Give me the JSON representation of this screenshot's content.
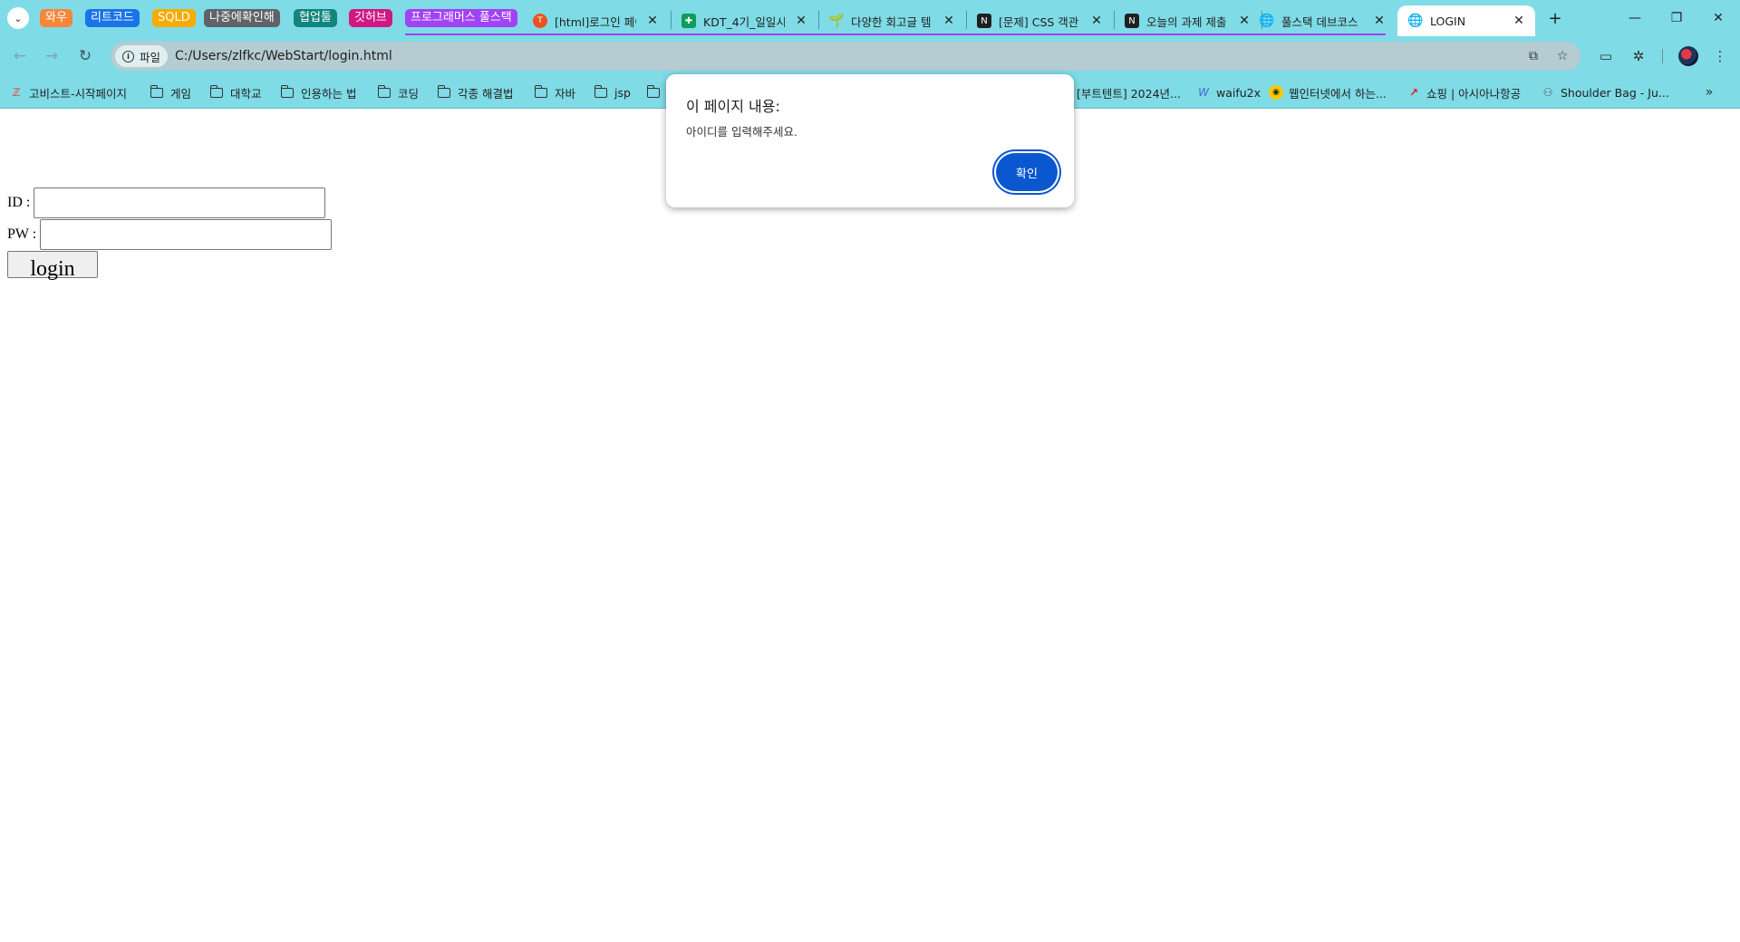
{
  "tab_groups": [
    {
      "label": "와우",
      "color": "#f6863a"
    },
    {
      "label": "리트코드",
      "color": "#1a73e8"
    },
    {
      "label": "SQLD",
      "color": "#f9ab00"
    },
    {
      "label": "나중에확인해",
      "color": "#5f6368"
    },
    {
      "label": "협업툴",
      "color": "#12857c"
    },
    {
      "label": "깃허브",
      "color": "#d01884"
    },
    {
      "label": "프로그래머스 풀스택",
      "color": "#a142f4"
    }
  ],
  "tabs": [
    {
      "title": "[html]로그인 페이",
      "icon": "tistory-icon",
      "color": "#eb531f"
    },
    {
      "title": "KDT_4기_일일시",
      "icon": "sheets-icon",
      "color": "#0f9d58"
    },
    {
      "title": "다양한 회고글 템",
      "icon": "sprout-icon",
      "color": "#2e7d32"
    },
    {
      "title": "[문제] CSS 객관",
      "icon": "notion-icon",
      "color": "#1f1f1f"
    },
    {
      "title": "오늘의 과제 제출",
      "icon": "notion-icon",
      "color": "#1f1f1f"
    },
    {
      "title": "풀스택 데브코스",
      "icon": "globe-icon",
      "color": "#5f6368"
    },
    {
      "title": "LOGIN",
      "icon": "globe-icon",
      "color": "#5f6368"
    }
  ],
  "omnibox": {
    "chip_label": "파일",
    "url": "C:/Users/zlfkc/WebStart/login.html"
  },
  "bookmarks": [
    {
      "label": "고비스트-시작페이지",
      "icon": "zum-icon"
    },
    {
      "label": "게임",
      "icon": "folder-icon"
    },
    {
      "label": "대학교",
      "icon": "folder-icon"
    },
    {
      "label": "인용하는 법",
      "icon": "folder-icon"
    },
    {
      "label": "코딩",
      "icon": "folder-icon"
    },
    {
      "label": "각종 해결법",
      "icon": "folder-icon"
    },
    {
      "label": "자바",
      "icon": "folder-icon"
    },
    {
      "label": "jsp",
      "icon": "folder-icon"
    },
    {
      "label": "",
      "icon": "folder-icon"
    },
    {
      "label": "[부트텐트] 2024년...",
      "icon": "folder-icon"
    },
    {
      "label": "waifu2x",
      "icon": "waifu-icon"
    },
    {
      "label": "웹인터넷에서 하는...",
      "icon": "webtoon-icon"
    },
    {
      "label": "쇼핑 | 아시아나항공",
      "icon": "asiana-icon"
    },
    {
      "label": "Shoulder Bag - Ju...",
      "icon": "bag-icon"
    }
  ],
  "form": {
    "id_label": "ID : ",
    "pw_label": "PW : ",
    "id_value": "",
    "pw_value": "",
    "login_label": "login"
  },
  "dialog": {
    "title": "이 페이지 내용:",
    "message": "아이디를 입력해주세요.",
    "ok_label": "확인"
  }
}
